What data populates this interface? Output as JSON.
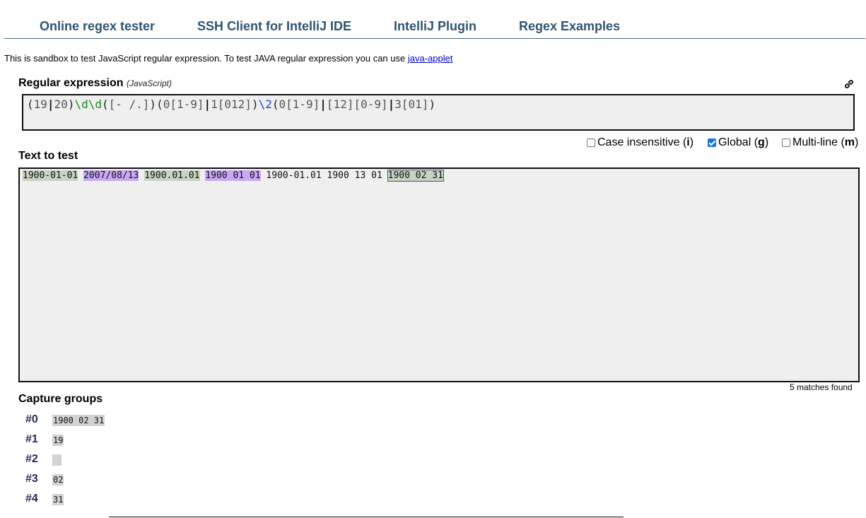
{
  "nav": {
    "items": [
      {
        "label": "Online regex tester"
      },
      {
        "label": "SSH Client for IntelliJ IDE"
      },
      {
        "label": "IntelliJ Plugin"
      },
      {
        "label": "Regex Examples"
      }
    ]
  },
  "intro": {
    "text": "This is sandbox to test JavaScript regular expression. To test JAVA regular expression you can use ",
    "link": "java-applet"
  },
  "regex_section": {
    "title": "Regular expression",
    "subtitle": "(JavaScript)",
    "link_icon": "link-icon",
    "tokens": [
      {
        "t": "(",
        "k": "paren"
      },
      {
        "t": "19",
        "k": "lit"
      },
      {
        "t": "|",
        "k": "bar"
      },
      {
        "t": "20",
        "k": "lit"
      },
      {
        "t": ")",
        "k": "paren"
      },
      {
        "t": "\\d\\d",
        "k": "esc"
      },
      {
        "t": "(",
        "k": "paren"
      },
      {
        "t": "[- /.]",
        "k": "lit"
      },
      {
        "t": ")",
        "k": "paren"
      },
      {
        "t": "(",
        "k": "paren"
      },
      {
        "t": "0[1-9]",
        "k": "lit"
      },
      {
        "t": "|",
        "k": "bar"
      },
      {
        "t": "1[012]",
        "k": "lit"
      },
      {
        "t": ")",
        "k": "paren"
      },
      {
        "t": "\\2",
        "k": "back"
      },
      {
        "t": "(",
        "k": "paren"
      },
      {
        "t": "0[1-9]",
        "k": "lit"
      },
      {
        "t": "|",
        "k": "bar"
      },
      {
        "t": "[12][0-9]",
        "k": "lit"
      },
      {
        "t": "|",
        "k": "bar"
      },
      {
        "t": "3[01]",
        "k": "lit"
      },
      {
        "t": ")",
        "k": "paren"
      }
    ]
  },
  "flags": [
    {
      "label_pre": "Case insensitive (",
      "key": "i",
      "label_post": ")",
      "checked": false
    },
    {
      "label_pre": "Global (",
      "key": "g",
      "label_post": ")",
      "checked": true
    },
    {
      "label_pre": "Multi-line (",
      "key": "m",
      "label_post": ")",
      "checked": false
    }
  ],
  "test_section": {
    "title": "Text to test",
    "segments": [
      {
        "t": "1900-01-01",
        "hl": "a"
      },
      {
        "t": " ",
        "hl": ""
      },
      {
        "t": "2007/08/13",
        "hl": "b"
      },
      {
        "t": " ",
        "hl": ""
      },
      {
        "t": "1900.01.01",
        "hl": "a"
      },
      {
        "t": " ",
        "hl": ""
      },
      {
        "t": "1900 01 01",
        "hl": "b"
      },
      {
        "t": " 1900-01.01 1900 13 01 ",
        "hl": ""
      },
      {
        "t": "1900 02 31",
        "hl": "sel"
      }
    ],
    "matches_text": "5 matches found"
  },
  "capture_section": {
    "title": "Capture groups",
    "groups": [
      {
        "label": "#0",
        "value": "1900 02 31"
      },
      {
        "label": "#1",
        "value": "19"
      },
      {
        "label": "#2",
        "value": " "
      },
      {
        "label": "#3",
        "value": "02"
      },
      {
        "label": "#4",
        "value": "31"
      }
    ]
  }
}
